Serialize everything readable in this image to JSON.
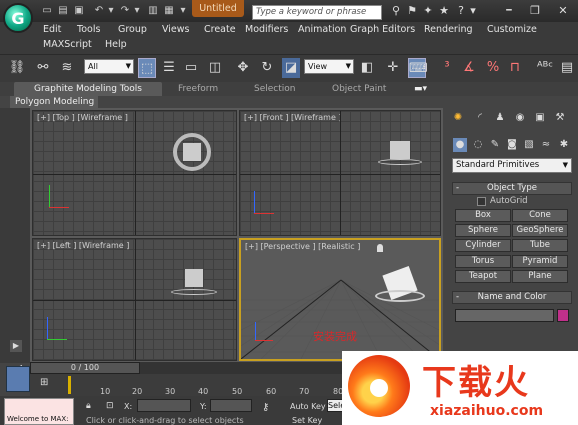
{
  "titlebar": {
    "app_logo": "3ds-max-logo",
    "document_title": "Untitled",
    "search_placeholder": "Type a keyword or phrase"
  },
  "menubar": {
    "items": [
      "Edit",
      "Tools",
      "Group",
      "Views",
      "Create",
      "Modifiers",
      "Animation",
      "Graph Editors",
      "Rendering",
      "Customize",
      "MAXScript",
      "Help"
    ]
  },
  "toolbar": {
    "selection_filter": "All",
    "reference_coord": "View"
  },
  "ribbon": {
    "tabs": [
      "Graphite Modeling Tools",
      "Freeform",
      "Selection",
      "Object Paint"
    ],
    "active_tab": "Graphite Modeling Tools",
    "panel_label": "Polygon Modeling"
  },
  "viewports": {
    "top": "[+] [Top ] [Wireframe ]",
    "front": "[+] [Front ] [Wireframe ]",
    "left": "[+] [Left ] [Wireframe ]",
    "perspective": "[+] [Perspective ] [Realistic ]",
    "perspective_overlay_text": "安装完成"
  },
  "command_panel": {
    "category": "Standard Primitives",
    "object_type_header": "Object Type",
    "autogrid_label": "AutoGrid",
    "buttons": [
      "Box",
      "Cone",
      "Sphere",
      "GeoSphere",
      "Cylinder",
      "Tube",
      "Torus",
      "Pyramid",
      "Teapot",
      "Plane"
    ],
    "name_color_header": "Name and Color",
    "object_color": "#c0308a"
  },
  "timeline": {
    "frame_display": "0 / 100",
    "ticks": [
      "10",
      "20",
      "30",
      "40",
      "50",
      "60",
      "70",
      "80"
    ]
  },
  "status": {
    "maxscript_text": "Welcome to MAX:",
    "x_label": "X:",
    "y_label": "Y:",
    "autokey_label": "Auto Key",
    "setkey_label": "Set Key",
    "selected_value": "Sele",
    "prompt": "Click or click-and-drag to select objects"
  },
  "watermark": {
    "text_cn": "下载火",
    "text_en": "xiazaihuo.com"
  },
  "colors": {
    "title_tab": "#a85a1a",
    "viewport_active_border": "#c8a020",
    "watermark_red": "#e8381c"
  }
}
